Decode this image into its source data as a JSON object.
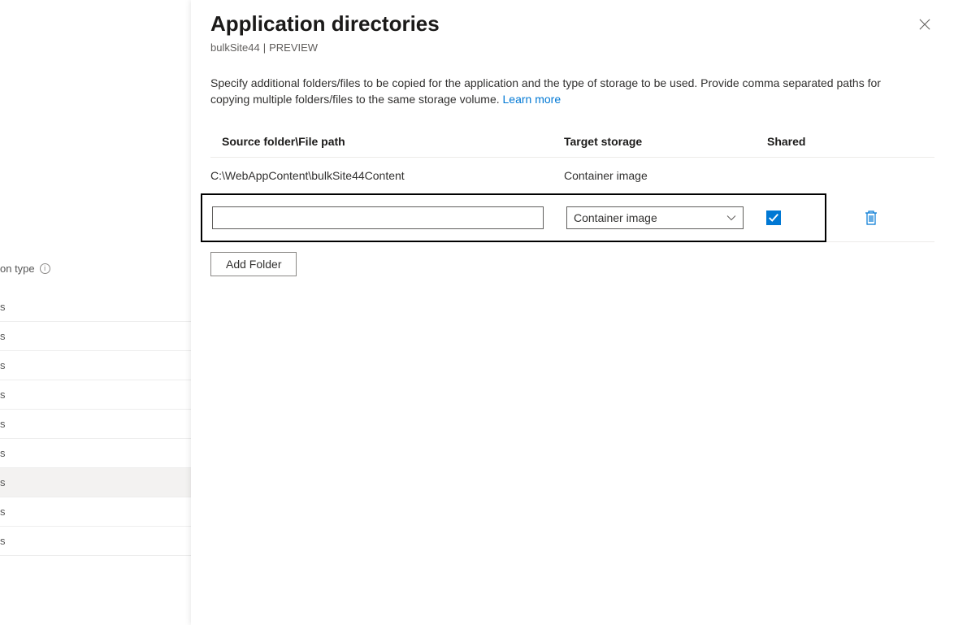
{
  "sidebar": {
    "header_fragment": "on type",
    "row_letter": "s"
  },
  "panel": {
    "title": "Application directories",
    "subtitle_site": "bulkSite44",
    "subtitle_preview": "PREVIEW",
    "description_text": "Specify additional folders/files to be copied for the application and the type of storage to be used. Provide comma separated paths for copying multiple folders/files to the same storage volume. ",
    "learn_more": "Learn more"
  },
  "table": {
    "headers": {
      "source": "Source folder\\File path",
      "target": "Target storage",
      "shared": "Shared"
    },
    "row0": {
      "source": "C:\\WebAppContent\\bulkSite44Content",
      "target": "Container image"
    },
    "edit_row": {
      "source_value": "",
      "target_selected": "Container image",
      "shared_checked": true
    }
  },
  "buttons": {
    "add_folder": "Add Folder"
  }
}
